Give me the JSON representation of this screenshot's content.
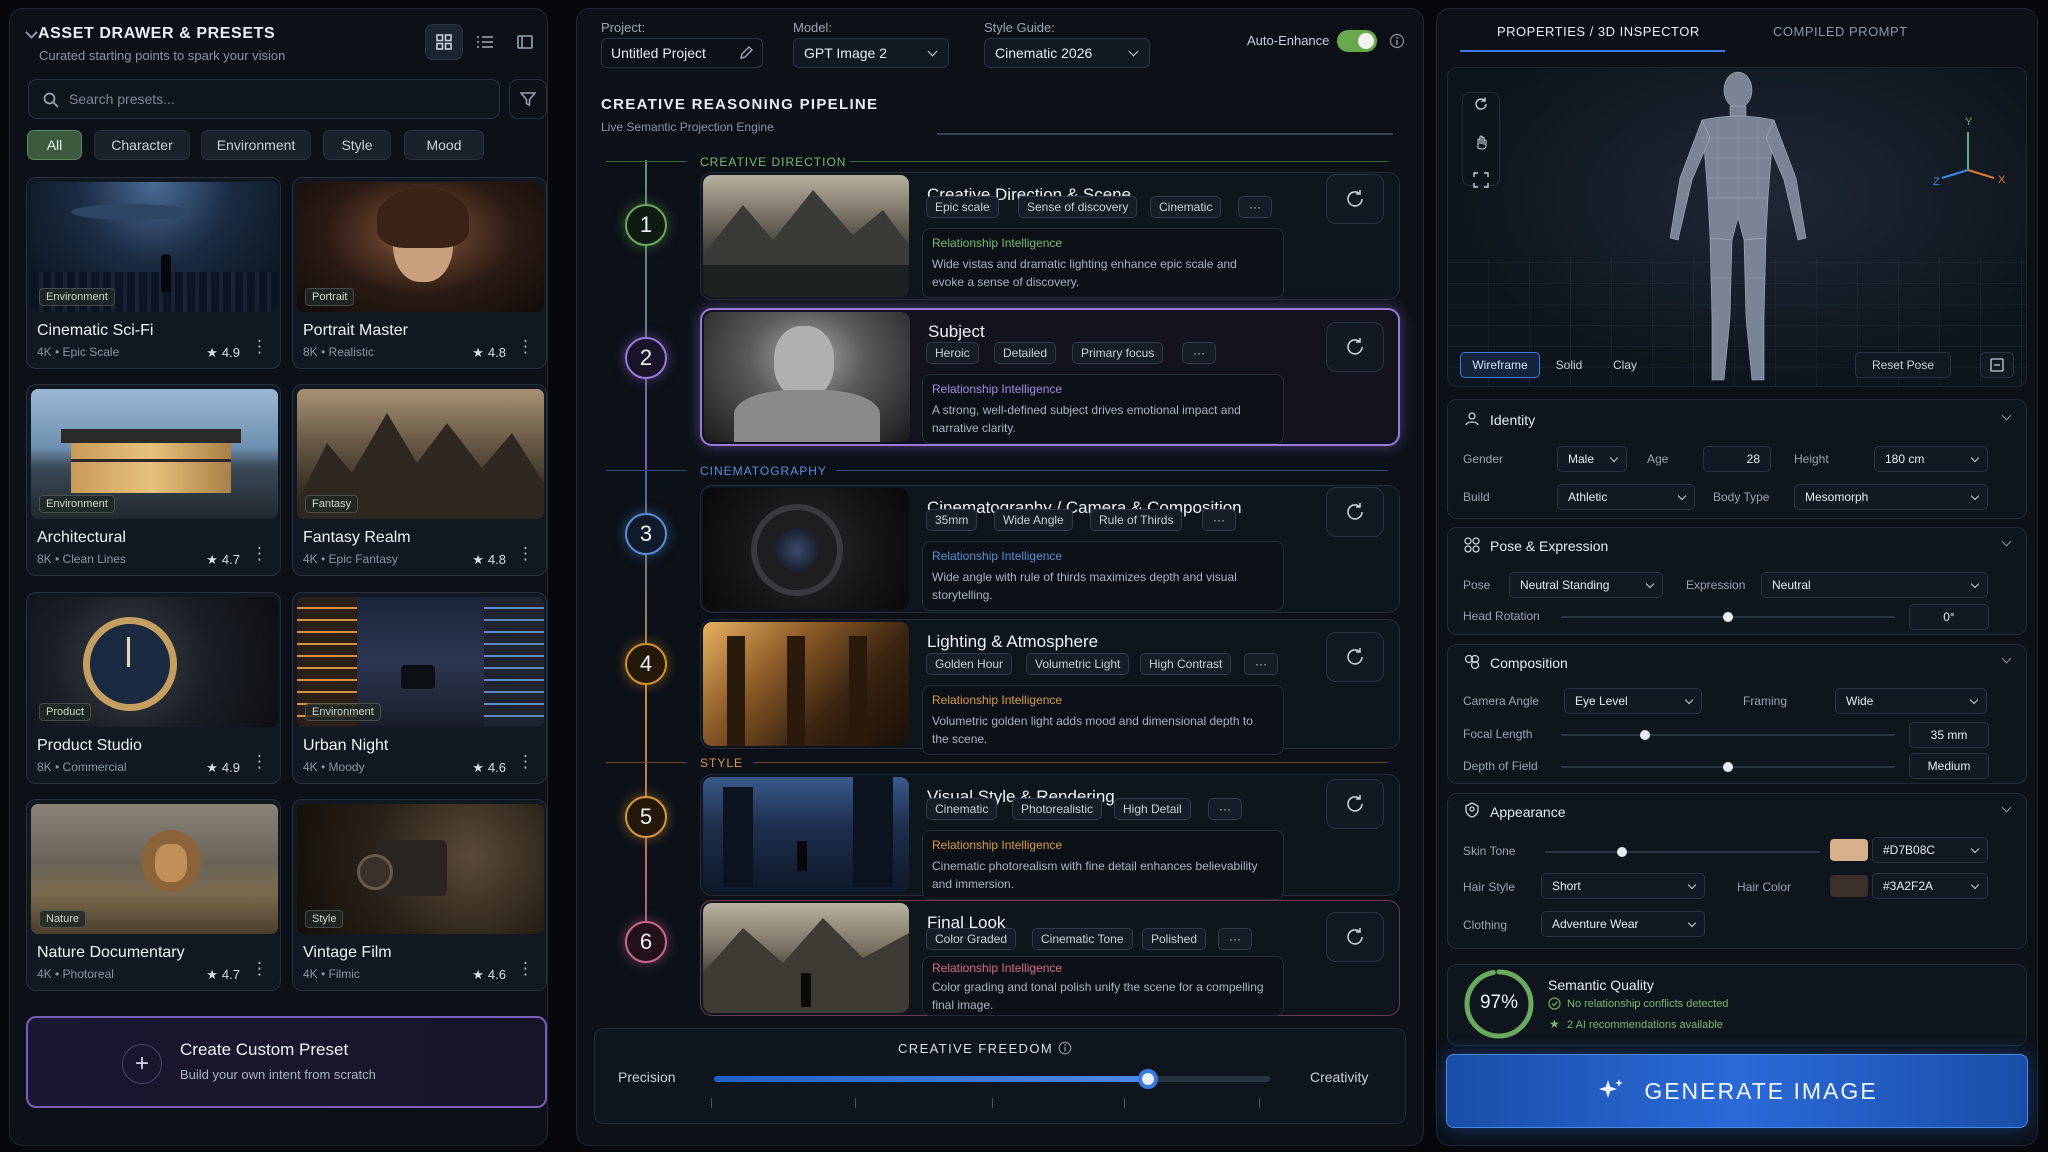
{
  "drawer": {
    "title": "ASSET DRAWER & PRESETS",
    "subtitle": "Curated starting points to spark your vision",
    "search_placeholder": "Search presets...",
    "filters": [
      "All",
      "Character",
      "Environment",
      "Style",
      "Mood"
    ],
    "presets": [
      {
        "tag": "Environment",
        "title": "Cinematic Sci-Fi",
        "meta": "4K • Epic Scale",
        "rating": "4.9"
      },
      {
        "tag": "Portrait",
        "title": "Portrait Master",
        "meta": "8K • Realistic",
        "rating": "4.8"
      },
      {
        "tag": "Environment",
        "title": "Architectural",
        "meta": "8K • Clean Lines",
        "rating": "4.7"
      },
      {
        "tag": "Fantasy",
        "title": "Fantasy Realm",
        "meta": "4K • Epic Fantasy",
        "rating": "4.8"
      },
      {
        "tag": "Product",
        "title": "Product Studio",
        "meta": "8K • Commercial",
        "rating": "4.9"
      },
      {
        "tag": "Environment",
        "title": "Urban Night",
        "meta": "4K • Moody",
        "rating": "4.6"
      },
      {
        "tag": "Nature",
        "title": "Nature Documentary",
        "meta": "4K • Photoreal",
        "rating": "4.7"
      },
      {
        "tag": "Style",
        "title": "Vintage Film",
        "meta": "4K • Filmic",
        "rating": "4.6"
      }
    ],
    "create": {
      "title": "Create Custom Preset",
      "subtitle": "Build your own intent from scratch"
    }
  },
  "topbar": {
    "project_label": "Project:",
    "project_value": "Untitled Project",
    "model_label": "Model:",
    "model_value": "GPT Image 2",
    "style_label": "Style Guide:",
    "style_value": "Cinematic 2026",
    "auto_enhance": "Auto-Enhance"
  },
  "pipeline": {
    "title": "CREATIVE REASONING PIPELINE",
    "subtitle": "Live Semantic Projection Engine",
    "sections": [
      "CREATIVE DIRECTION",
      "CINEMATOGRAPHY",
      "STYLE"
    ],
    "ri_label": "Relationship Intelligence",
    "steps": [
      {
        "num": "1",
        "title": "Creative Direction & Scene",
        "tags": [
          "Epic scale",
          "Sense of discovery",
          "Cinematic"
        ],
        "text": "Wide vistas and dramatic lighting enhance epic scale and evoke a sense of discovery."
      },
      {
        "num": "2",
        "title": "Subject",
        "tags": [
          "Heroic",
          "Detailed",
          "Primary focus"
        ],
        "text": "A strong, well-defined subject drives emotional impact and narrative clarity."
      },
      {
        "num": "3",
        "title": "Cinematography / Camera & Composition",
        "tags": [
          "35mm",
          "Wide Angle",
          "Rule of Thirds"
        ],
        "text": "Wide angle with rule of thirds maximizes depth and visual storytelling."
      },
      {
        "num": "4",
        "title": "Lighting & Atmosphere",
        "tags": [
          "Golden Hour",
          "Volumetric Light",
          "High Contrast"
        ],
        "text": "Volumetric golden light adds mood and dimensional depth to the scene."
      },
      {
        "num": "5",
        "title": "Visual Style & Rendering",
        "tags": [
          "Cinematic",
          "Photorealistic",
          "High Detail"
        ],
        "text": "Cinematic photorealism with fine detail enhances believability and immersion."
      },
      {
        "num": "6",
        "title": "Final Look",
        "tags": [
          "Color Graded",
          "Cinematic Tone",
          "Polished"
        ],
        "text": "Color grading and tonal polish unify the scene for a compelling final image."
      }
    ],
    "more": "···"
  },
  "freedom": {
    "title": "CREATIVE FREEDOM",
    "left": "Precision",
    "right": "Creativity",
    "value": 0.78
  },
  "inspector": {
    "tabs": [
      "PROPERTIES / 3D INSPECTOR",
      "COMPILED PROMPT"
    ],
    "view_modes": [
      "Wireframe",
      "Solid",
      "Clay"
    ],
    "reset_pose": "Reset Pose",
    "axes": {
      "x": "X",
      "y": "Y",
      "z": "Z"
    },
    "identity": {
      "title": "Identity",
      "gender_label": "Gender",
      "gender": "Male",
      "age_label": "Age",
      "age": "28",
      "height_label": "Height",
      "height": "180 cm",
      "build_label": "Build",
      "build": "Athletic",
      "body_label": "Body Type",
      "body": "Mesomorph"
    },
    "pose": {
      "title": "Pose & Expression",
      "pose_label": "Pose",
      "pose": "Neutral Standing",
      "expr_label": "Expression",
      "expr": "Neutral",
      "head_label": "Head Rotation",
      "head": "0°",
      "head_level": 0.5
    },
    "composition": {
      "title": "Composition",
      "angle_label": "Camera Angle",
      "angle": "Eye Level",
      "framing_label": "Framing",
      "framing": "Wide",
      "focal_label": "Focal Length",
      "focal": "35 mm",
      "focal_level": 0.25,
      "dof_label": "Depth of Field",
      "dof": "Medium",
      "dof_level": 0.5
    },
    "appearance": {
      "title": "Appearance",
      "skin_label": "Skin Tone",
      "skin": "#D7B08C",
      "skin_level": 0.28,
      "hairstyle_label": "Hair Style",
      "hairstyle": "Short",
      "haircolor_label": "Hair Color",
      "haircolor": "#3A2F2A",
      "clothing_label": "Clothing",
      "clothing": "Adventure Wear"
    },
    "quality": {
      "percent": "97%",
      "title": "Semantic Quality",
      "line1": "No relationship conflicts detected",
      "line2": "2 AI recommendations available",
      "level": 0.97
    },
    "generate": "GENERATE IMAGE"
  }
}
